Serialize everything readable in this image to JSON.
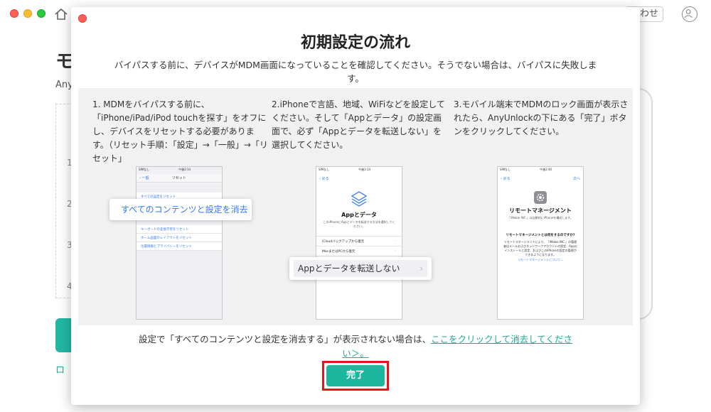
{
  "background": {
    "contact_label": "合わせ",
    "title_fragment": "モ",
    "subtitle_fragment": "Any",
    "step_numbers": [
      "1",
      "2",
      "3",
      "4"
    ],
    "link_fragment": "ロ"
  },
  "dialog": {
    "title": "初期設定の流れ",
    "description": "バイパスする前に、デバイスがMDM画面になっていることを確認してください。そうでない場合は、バイパスに失敗します。",
    "steps": [
      {
        "text": "1. MDMをバイパスする前に、「iPhone/iPad/iPod touchを探す」をオフにし、デバイスをリセットする必要があります。（リセット手順：「設定」→「一般」→「リセット」",
        "callout": "すべてのコンテンツと設定を消去",
        "phone": {
          "status_left": "SIMなし",
          "status_time": "午後3:14",
          "back": "一般",
          "title": "リセット",
          "rows_top": [
            "すべての設定をリセット"
          ],
          "rows_mid": [
            "ネットワーク設定をリセット"
          ],
          "rows_bottom": [
            "キーボードの変換学習をリセット",
            "ホーム画面のレイアウトをリセット",
            "位置情報とプライバシーをリセット"
          ]
        }
      },
      {
        "text": "2.iPhoneで言語、地域、WiFiなどを設定してください。そして「Appとデータ」の設定画面で、必ず「Appとデータを転送しない」を選択してください。",
        "callout": "Appとデータを転送しない",
        "phone": {
          "status_left": "SIMなし",
          "status_time": "午後3:14",
          "back": "戻る",
          "heading": "Appとデータ",
          "desc": "このiPhoneにAppとデータを転送する方法を選択してください。",
          "items": [
            "iCloudバックアップから復元",
            "MacまたはPCから復元"
          ]
        }
      },
      {
        "text": "3.モバイル端末でMDMのロック画面が表示されたら、AnyUnlockの下にある「完了」ボタンをクリックしてください。",
        "phone": {
          "status_left": "SIMなし",
          "status_time": "午後2:40",
          "back": "戻る",
          "next": "次へ",
          "heading": "リモートマネージメント",
          "sub": "「iMobie INC.」は自動的にiPhoneを構成します。",
          "question": "リモートマネージメントとは何をするのですか?",
          "body": "リモートマネージメントにより、「iMobie INC.」の管理者はメールおよびネットワークアカウントの設定、Appのインストールと設定、およびこのiPhoneの設定の管理ができるようになります。",
          "link": "リモートマネージメントについて..."
        }
      }
    ],
    "footer_text": "設定で「すべてのコンテンツと設定を消去する」が表示されない場合は、",
    "footer_link": "ここをクリックして消去してください＞。",
    "done_label": "完了"
  },
  "colors": {
    "accent": "#1db79e",
    "highlight": "#e8141c",
    "ios_blue": "#3478f6"
  }
}
